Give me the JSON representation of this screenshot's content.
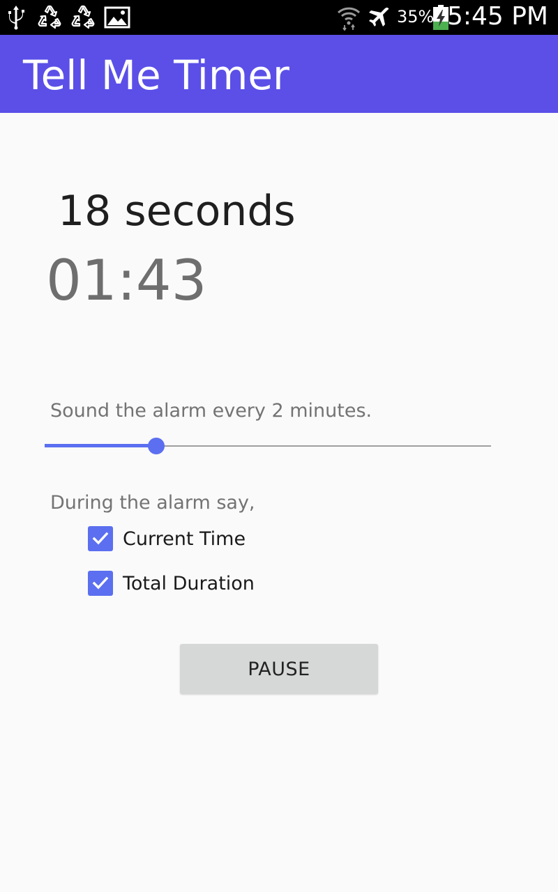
{
  "status_bar": {
    "icons_left": [
      "usb-icon",
      "recycle-icon",
      "recycle-icon",
      "image-icon"
    ],
    "icons_right": [
      "wifi-icon",
      "airplane-icon"
    ],
    "battery_percent": "35%",
    "battery_level": 0.35,
    "time": "5:45 PM"
  },
  "app_bar": {
    "title": "Tell Me Timer",
    "color": "#5b4fe8"
  },
  "timer": {
    "interval_text": "18 seconds",
    "elapsed_text": "01:43"
  },
  "alarm": {
    "label": "Sound the alarm every 2 minutes.",
    "slider_value": 0.25,
    "accent_color": "#5b6ff0"
  },
  "speech": {
    "label": "During the alarm say,",
    "options": [
      {
        "label": "Current Time",
        "checked": true
      },
      {
        "label": "Total Duration",
        "checked": true
      }
    ]
  },
  "controls": {
    "pause_label": "PAUSE"
  }
}
